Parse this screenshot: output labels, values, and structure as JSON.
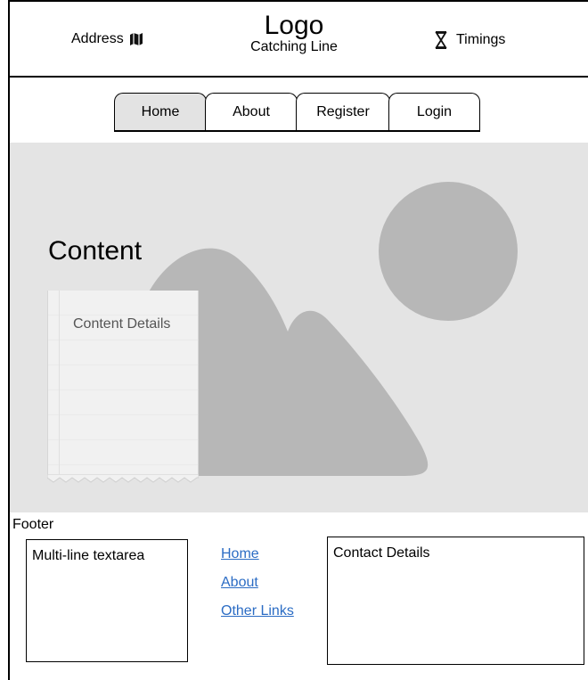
{
  "header": {
    "address_label": "Address",
    "logo_title": "Logo",
    "logo_subtitle": "Catching Line",
    "timings_label": "Timings",
    "icons": [
      "map-icon",
      "hourglass-icon"
    ]
  },
  "nav": {
    "tabs": [
      {
        "label": "Home",
        "active": true
      },
      {
        "label": "About",
        "active": false
      },
      {
        "label": "Register",
        "active": false
      },
      {
        "label": "Login",
        "active": false
      }
    ]
  },
  "hero": {
    "heading": "Content",
    "details": "Content Details",
    "image_placeholder": "image-placeholder-icon"
  },
  "footer": {
    "label": "Footer",
    "textarea_text": "Multi-line textarea",
    "links": [
      "Home",
      "About",
      "Other Links"
    ],
    "contact_text": "Contact Details"
  },
  "colors": {
    "hero_bg": "#e4e4e4",
    "placeholder_shape": "#b7b7b7",
    "active_tab": "#e3e3e3",
    "link": "#2b6cc4"
  }
}
